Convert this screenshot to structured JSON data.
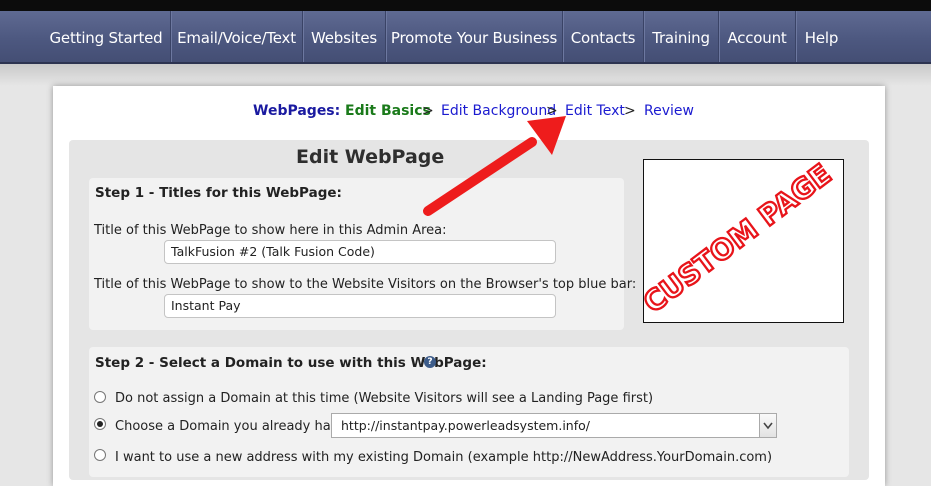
{
  "nav": {
    "items": [
      {
        "label": "Getting Started"
      },
      {
        "label": "Email/Voice/Text"
      },
      {
        "label": "Websites"
      },
      {
        "label": "Promote Your Business"
      },
      {
        "label": "Contacts"
      },
      {
        "label": "Training"
      },
      {
        "label": "Account"
      },
      {
        "label": "Help"
      }
    ]
  },
  "breadcrumb": {
    "lead": "WebPages:",
    "steps": [
      "Edit Basics",
      "Edit Background",
      "Edit Text",
      "Review"
    ],
    "separator": ">"
  },
  "page_title": "Edit WebPage",
  "step1": {
    "title": "Step 1 - Titles for this WebPage:",
    "admin_label": "Title of this WebPage to show here in this Admin Area:",
    "admin_value": "TalkFusion #2 (Talk Fusion Code)",
    "browser_label": "Title of this WebPage to show to the Website Visitors on the Browser's top blue bar:",
    "browser_value": "Instant Pay"
  },
  "preview": {
    "stamp_text": "CUSTOM PAGE",
    "stamp_color": "#e8141a"
  },
  "step2": {
    "title": "Step 2 - Select a Domain to use with this WebPage:",
    "help_icon": "?",
    "options": [
      {
        "label": "Do not assign a Domain at this time (Website Visitors will see a Landing Page first)",
        "checked": false
      },
      {
        "label": "Choose a Domain you already have:",
        "checked": true
      },
      {
        "label": "I want to use a new address with my existing Domain (example http://NewAddress.YourDomain.com)",
        "checked": false
      }
    ],
    "domain_selected": "http://instantpay.powerleadsystem.info/"
  },
  "annotation": {
    "arrow_color": "#ee1c1c",
    "icon": "red-arrow-icon"
  }
}
